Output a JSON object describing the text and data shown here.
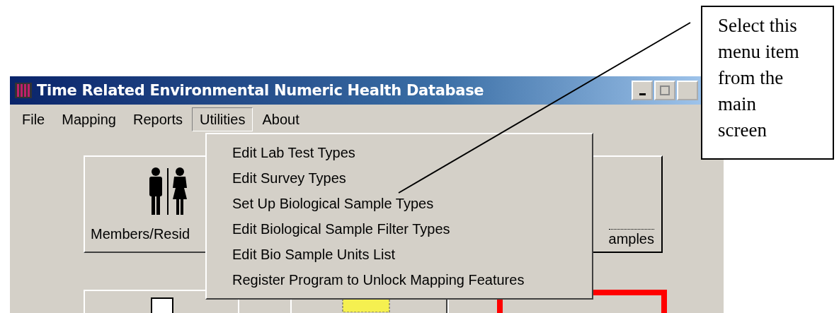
{
  "window": {
    "title": "Time Related Environmental Numeric Health Database"
  },
  "menu_bar": [
    {
      "label": "File",
      "selected": false
    },
    {
      "label": "Mapping",
      "selected": false
    },
    {
      "label": "Reports",
      "selected": false
    },
    {
      "label": "Utilities",
      "selected": true
    },
    {
      "label": "About",
      "selected": false
    }
  ],
  "dropdown": [
    "Edit Lab Test Types",
    "Edit Survey Types",
    "Set Up Biological Sample Types",
    "Edit Biological Sample Filter Types",
    "Edit Bio Sample Units List",
    "Register Program to Unlock Mapping Features"
  ],
  "buttons": [
    {
      "label": "Members/Resid",
      "kind": "people"
    },
    {
      "label": "amples",
      "kind": "sample"
    }
  ],
  "callout": {
    "text": "Select this menu item from the main screen"
  }
}
